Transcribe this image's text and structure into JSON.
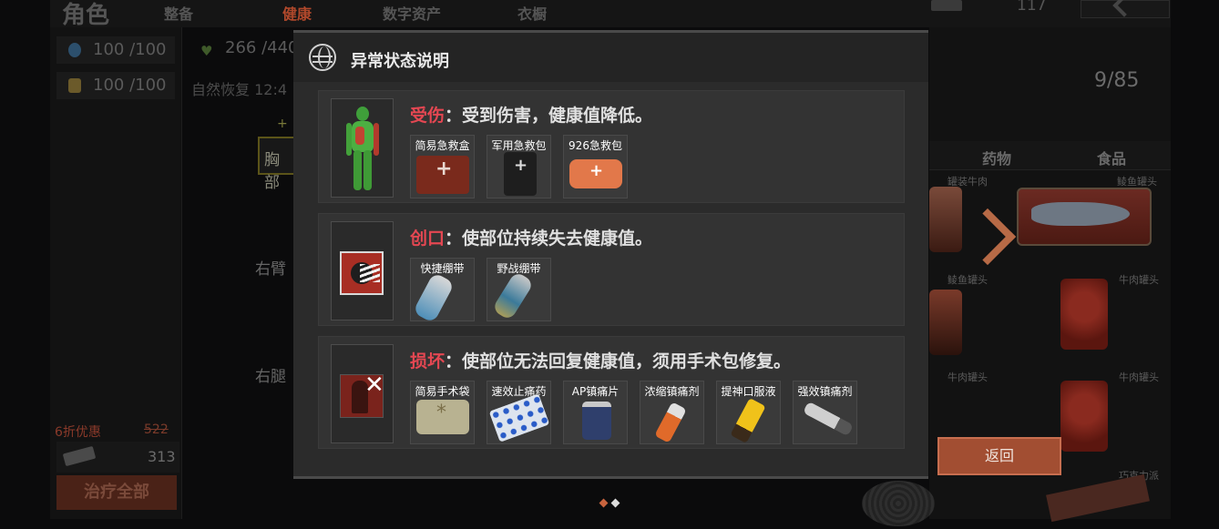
{
  "background": {
    "title": "角色",
    "tabs": [
      {
        "label": "整备",
        "active": false
      },
      {
        "label": "健康",
        "active": true
      },
      {
        "label": "数字资产",
        "active": false
      },
      {
        "label": "衣橱",
        "active": false
      }
    ],
    "top_count": "117",
    "stats": {
      "water": "100 /100",
      "energy": "100 /100",
      "health": "266 /440",
      "recovery": "自然恢复 12:4"
    },
    "body_parts": {
      "plus": "+",
      "chest": "胸部",
      "right_arm": "右臂",
      "right_leg": "右腿"
    },
    "discount": "6折优惠",
    "old_price": "522",
    "price": "313",
    "heal_all": "治疗全部",
    "inventory": {
      "count": "9/85",
      "tabs": [
        "药物",
        "食品"
      ],
      "labels": [
        "罐装牛肉",
        "鲮鱼罐头",
        "鲮鱼罐头",
        "牛肉罐头",
        "牛肉罐头",
        "牛肉罐头",
        "巧克力派"
      ]
    },
    "return_label": "返回"
  },
  "modal": {
    "title": "异常状态说明",
    "icon": "globe-icon",
    "statuses": [
      {
        "name": "受伤",
        "description": "：受到伤害，健康值降低。",
        "icon": "injured-body-icon",
        "items": [
          "简易急救盒",
          "军用急救包",
          "926急救包"
        ]
      },
      {
        "name": "创口",
        "description": "：使部位持续失去健康值。",
        "icon": "wound-icon",
        "items": [
          "快捷绷带",
          "野战绷带"
        ]
      },
      {
        "name": "损坏",
        "description": "：使部位无法回复健康值，须用手术包修复。",
        "icon": "broken-limb-icon",
        "items": [
          "简易手术袋",
          "速效止痛药",
          "AP镇痛片",
          "浓缩镇痛剂",
          "提神口服液",
          "强效镇痛剂"
        ]
      }
    ]
  },
  "pagination": {
    "pages": 2,
    "current": 1
  },
  "colors": {
    "accent": "#a24e32",
    "status_name": "#e44752",
    "modal_bg": "#2b2b2b"
  }
}
